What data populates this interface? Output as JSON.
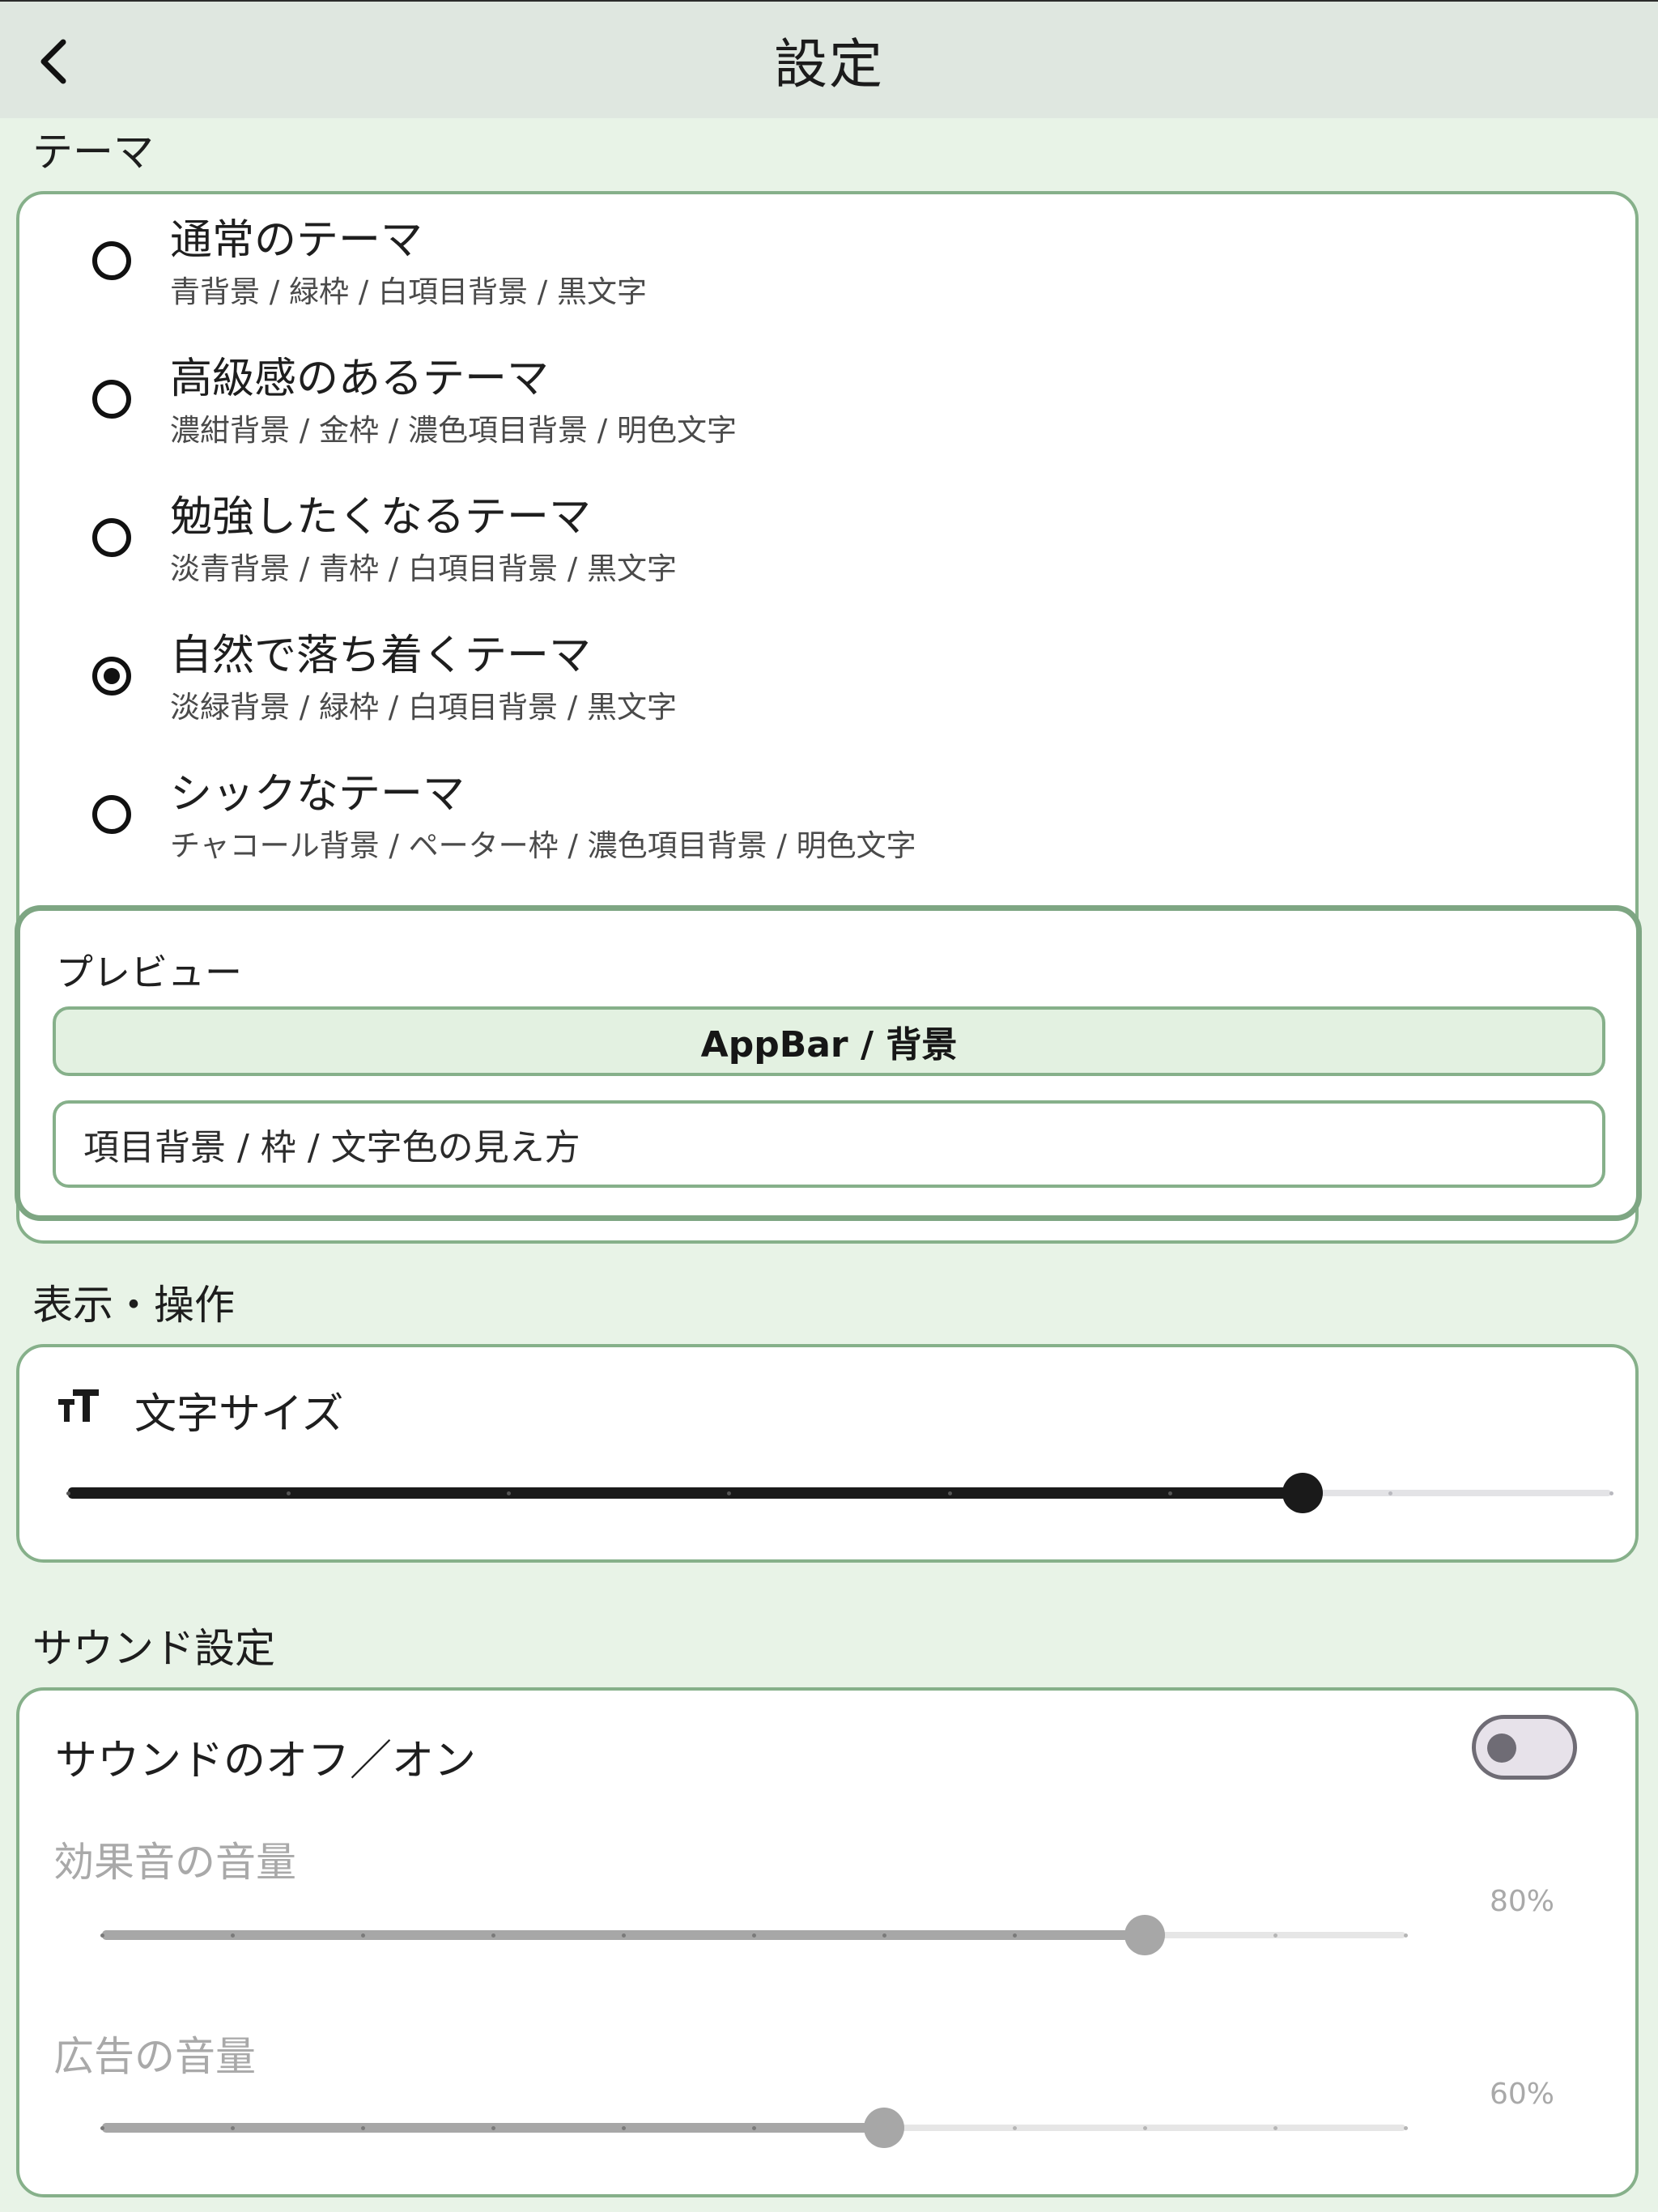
{
  "appbar": {
    "title": "設定",
    "back_icon": "chevron-left-icon"
  },
  "theme_section": {
    "label": "テーマ",
    "options": [
      {
        "title": "通常のテーマ",
        "subtitle": "青背景 / 緑枠 / 白項目背景 / 黒文字",
        "selected": false
      },
      {
        "title": "高級感のあるテーマ",
        "subtitle": "濃紺背景 / 金枠 / 濃色項目背景 / 明色文字",
        "selected": false
      },
      {
        "title": "勉強したくなるテーマ",
        "subtitle": "淡青背景 / 青枠 / 白項目背景 / 黒文字",
        "selected": false
      },
      {
        "title": "自然で落ち着くテーマ",
        "subtitle": "淡緑背景 / 緑枠 / 白項目背景 / 黒文字",
        "selected": true
      },
      {
        "title": "シックなテーマ",
        "subtitle": "チャコール背景 / ペーター枠 / 濃色項目背景 / 明色文字",
        "selected": false
      }
    ]
  },
  "preview": {
    "title": "プレビュー",
    "appbar_sample": "AppBar / 背景",
    "item_sample": "項目背景 / 枠 / 文字色の見え方"
  },
  "display_section": {
    "label": "表示・操作",
    "text_size": {
      "label": "文字サイズ",
      "icon": "text-size-icon",
      "level": 8,
      "divisions": 10
    }
  },
  "sound_section": {
    "label": "サウンド設定",
    "sound_toggle": {
      "label": "サウンドのオフ／オン",
      "on": false
    },
    "effect_volume": {
      "label": "効果音の音量",
      "value_text": "80%",
      "value": 0.8,
      "divisions": 10
    },
    "ad_volume": {
      "label": "広告の音量",
      "value_text": "60%",
      "value": 0.6,
      "divisions": 10
    }
  },
  "colors": {
    "background": "#e8f3e7",
    "appbar": "#dfe7e0",
    "card_border": "#86b08a",
    "slider_active": "#1a1a1a",
    "slider_inactive": "#e3e3e6",
    "disabled_active": "#a7a7a7",
    "disabled_inactive": "#e6e6e6"
  }
}
